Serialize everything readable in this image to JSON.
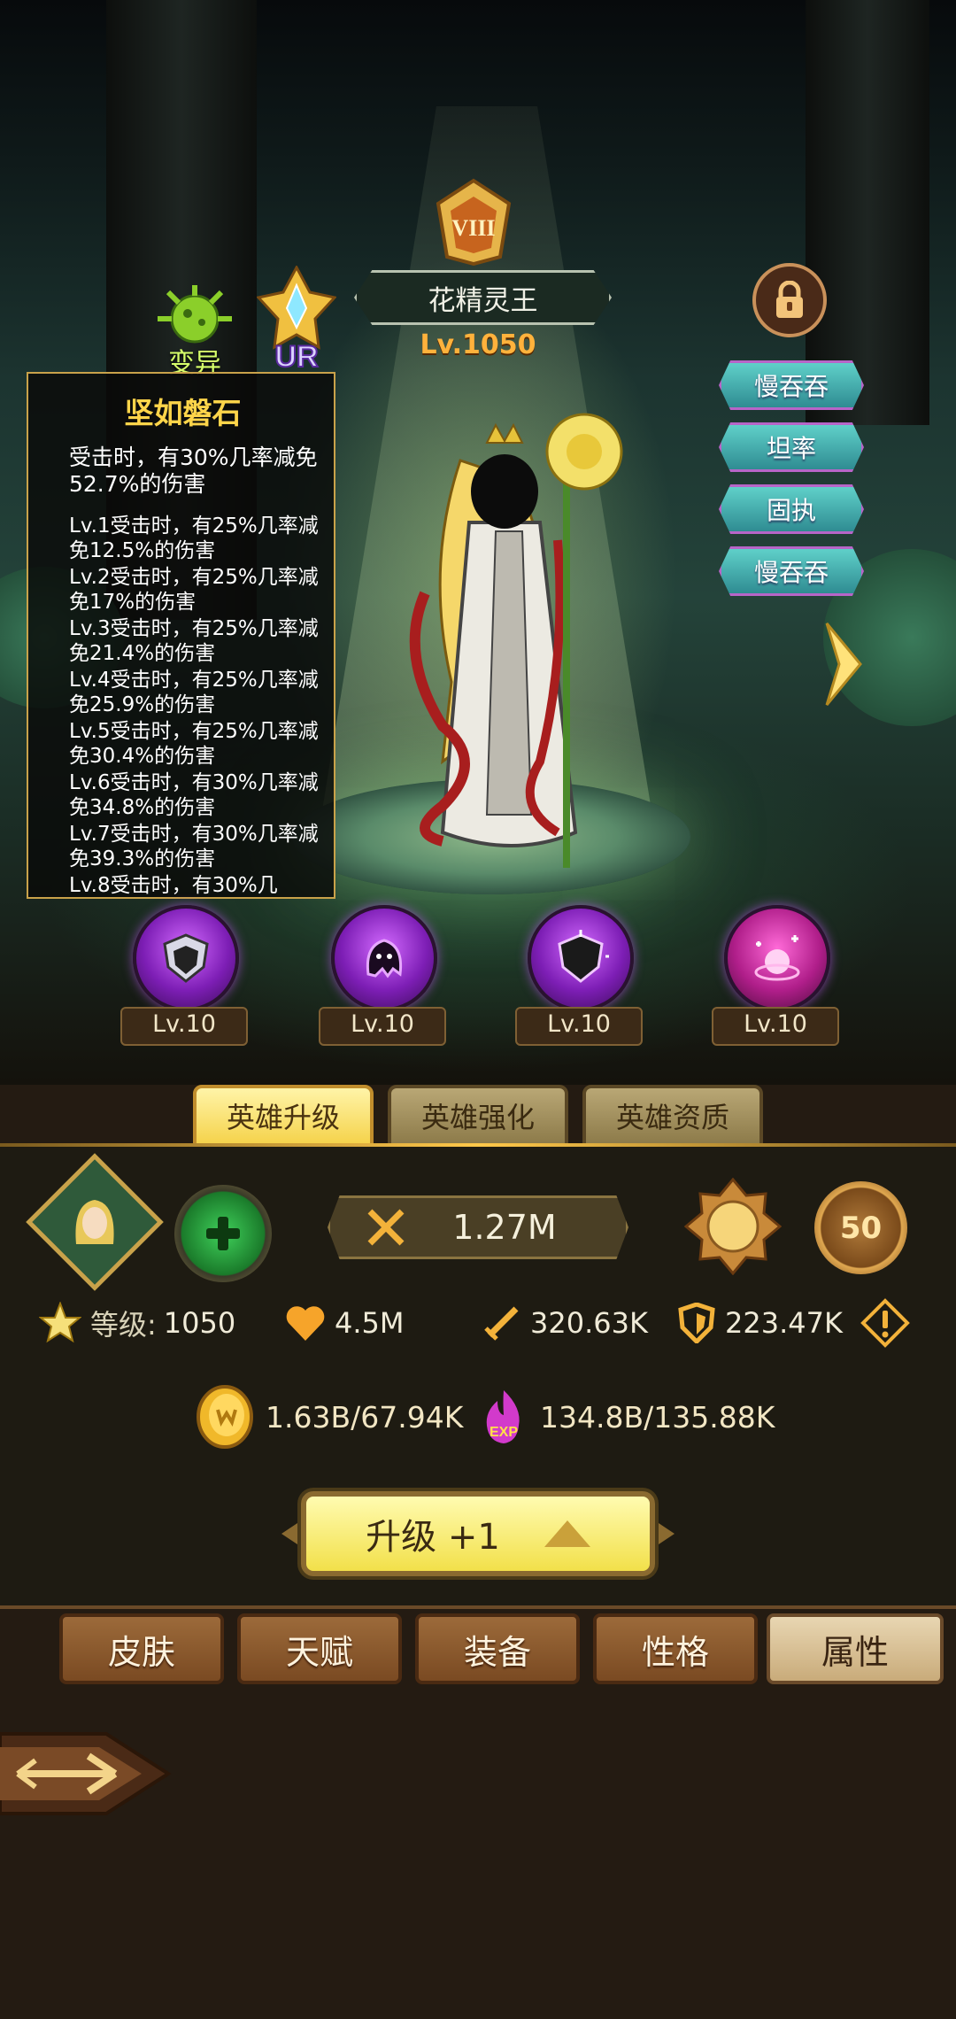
{
  "hero": {
    "rank_numeral": "VIII",
    "name": "花精灵王",
    "level": "Lv.1050",
    "mutation_label": "变异",
    "rarity": "UR"
  },
  "traits": [
    "慢吞吞",
    "坦率",
    "固执",
    "慢吞吞"
  ],
  "tooltip": {
    "title": "坚如磐石",
    "current": "受击时，有30%几率减免52.7%的伤害",
    "levels": [
      "Lv.1受击时，有25%几率减免12.5%的伤害",
      "Lv.2受击时，有25%几率减免17%的伤害",
      "Lv.3受击时，有25%几率减免21.4%的伤害",
      "Lv.4受击时，有25%几率减免25.9%的伤害",
      "Lv.5受击时，有25%几率减免30.4%的伤害",
      "Lv.6受击时，有30%几率减免34.8%的伤害",
      "Lv.7受击时，有30%几率减免39.3%的伤害",
      "Lv.8受击时，有30%几"
    ]
  },
  "skills": [
    {
      "level": "Lv.10",
      "icon": "shield-skill-icon"
    },
    {
      "level": "Lv.10",
      "icon": "ghost-skill-icon"
    },
    {
      "level": "Lv.10",
      "icon": "dark-shield-skill-icon"
    },
    {
      "level": "Lv.10",
      "icon": "pink-orb-skill-icon"
    }
  ],
  "tabs": [
    "英雄升级",
    "英雄强化",
    "英雄资质"
  ],
  "panel": {
    "power": "1.27M",
    "level_badge": "50",
    "stats": {
      "level_key": "等级:",
      "level_value": "1050",
      "hp": "4.5M",
      "attack": "320.63K",
      "defense": "223.47K"
    },
    "gold": "1.63B/67.94K",
    "exp_icon_label": "EXP",
    "exp": "134.8B/135.88K",
    "upgrade_label": "升级 +1"
  },
  "bottom_tabs": [
    "皮肤",
    "天赋",
    "装备",
    "性格",
    "属性"
  ],
  "colors": {
    "accent_gold": "#ffd54a",
    "level_orange": "#ffb23c",
    "tab_active": "#f5d34c",
    "trait_teal": "#5fd0c9"
  }
}
